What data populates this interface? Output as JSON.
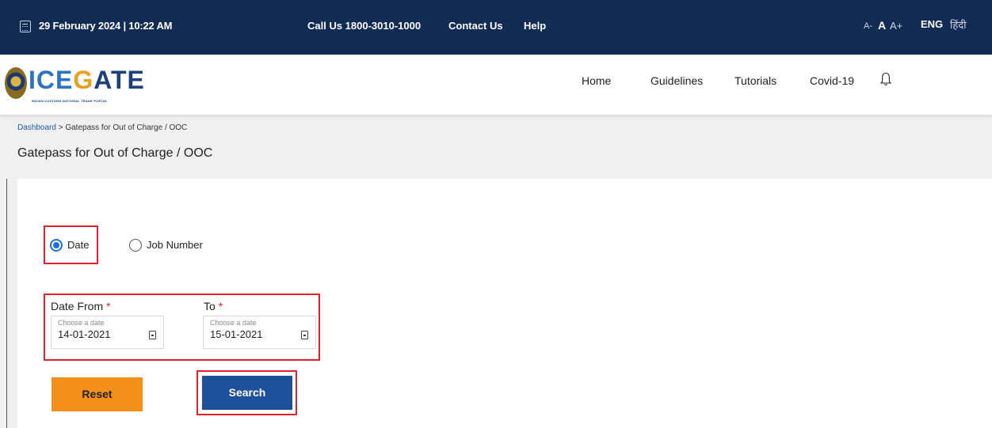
{
  "topbar": {
    "datetime": "29 February 2024 | 10:22 AM",
    "call_us": "Call Us  1800-3010-1000",
    "contact_us": "Contact Us",
    "help": "Help",
    "font_small": "A-",
    "font_normal": "A",
    "font_large": "A+",
    "lang_eng": "ENG",
    "lang_hindi": "हिंदी"
  },
  "logo": {
    "word_part1": "ICE",
    "word_part2": "G",
    "word_part3": "ATE",
    "tagline": "INDIAN CUSTOMS NATIONAL TRADE PORTAL"
  },
  "nav": {
    "home": "Home",
    "guidelines": "Guidelines",
    "tutorials": "Tutorials",
    "covid": "Covid-19"
  },
  "breadcrumb": {
    "dashboard": "Dashboard",
    "separator": " > ",
    "current": "Gatepass for Out of Charge / OOC"
  },
  "page_title": "Gatepass for Out of Charge / OOC",
  "form": {
    "radio_date": "Date",
    "radio_job": "Job Number",
    "selected": "Date",
    "date_from_label": "Date From",
    "to_label": "To",
    "required_mark": "*",
    "date_from": {
      "placeholder": "Choose a date",
      "value": "14-01-2021"
    },
    "date_to": {
      "placeholder": "Choose a date",
      "value": "15-01-2021"
    },
    "reset_label": "Reset",
    "search_label": "Search"
  },
  "colors": {
    "topbar_bg": "#112b53",
    "highlight": "#e0202a",
    "reset_bg": "#f39019",
    "search_bg": "#1e4f9a",
    "radio_accent": "#1e6fd9"
  }
}
